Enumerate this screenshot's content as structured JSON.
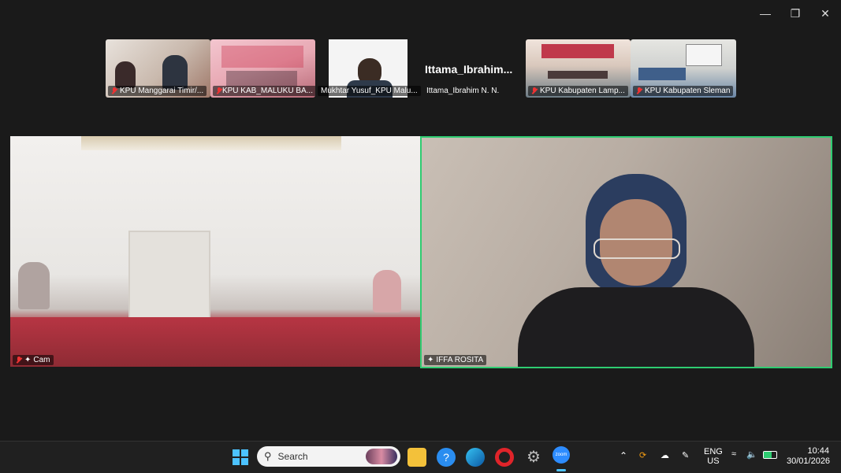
{
  "window": {
    "controls": [
      "minimize",
      "restore",
      "close"
    ]
  },
  "gallery": [
    {
      "name": "KPU Manggarai Timir/...",
      "muted": true
    },
    {
      "name": "KPU KAB_MALUKU BA...",
      "muted": true
    },
    {
      "name": "Mukhtar Yusuf_KPU Malu...",
      "muted": false
    },
    {
      "name": "Ittama_Ibrahim N. N.",
      "display": "Ittama_Ibrahim...",
      "muted": false
    },
    {
      "name": "KPU Kabupaten Lamp...",
      "muted": true
    },
    {
      "name": "KPU Kabupaten Sleman",
      "muted": true
    }
  ],
  "main_tiles": [
    {
      "name": "Cam",
      "muted": true,
      "active": false
    },
    {
      "name": "IFFA ROSITA",
      "muted": false,
      "active": true
    }
  ],
  "taskbar": {
    "search_placeholder": "Search",
    "lang_line1": "ENG",
    "lang_line2": "US",
    "time": "10:44",
    "date": "30/01/2026"
  },
  "colors": {
    "active_speaker_border": "#2ecc71",
    "taskbar_bg": "#202020",
    "muted_icon": "#e33333"
  }
}
